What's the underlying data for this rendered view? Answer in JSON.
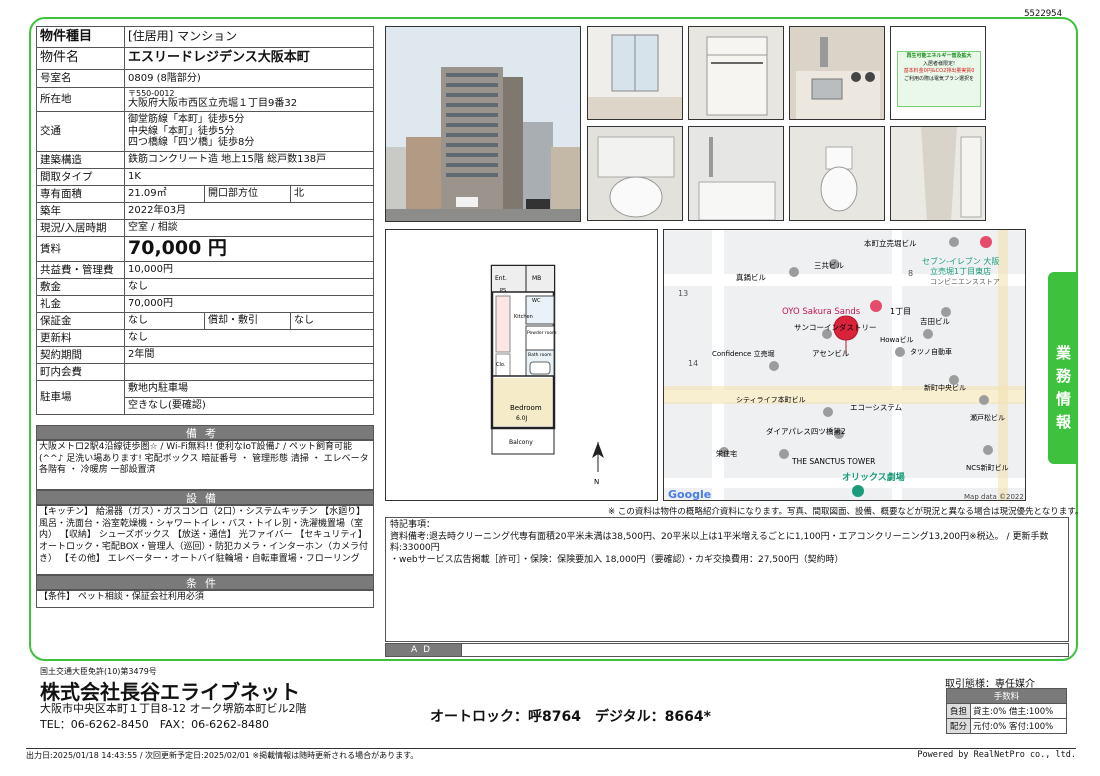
{
  "doc_id": "5522954",
  "property": {
    "type_label": "物件種目",
    "type_value": "[住居用] マンション",
    "name_label": "物件名",
    "name_value": "エスリードレジデンス大阪本町",
    "room_label": "号室名",
    "room_value": "0809 (8階部分)",
    "address_label": "所在地",
    "postal": "〒550-0012",
    "address_value": "大阪府大阪市西区立売堀１丁目9番32",
    "access_label": "交通",
    "access_lines": [
      "御堂筋線「本町」徒歩5分",
      "中央線「本町」徒歩5分",
      "四つ橋線「四ツ橋」徒歩8分"
    ],
    "structure_label": "建築構造",
    "structure_value": "鉄筋コンクリート造 地上15階 総戸数138戸",
    "layout_label": "間取タイプ",
    "layout_value": "1K",
    "area_label": "専有面積",
    "area_value": "21.09㎡",
    "direction_label": "開口部方位",
    "direction_value": "北",
    "built_label": "築年",
    "built_value": "2022年03月",
    "status_label": "現況/入居時期",
    "status_value": "空室 / 相談",
    "rent_label": "賃料",
    "rent_value": "70,000 円",
    "common_label": "共益費・管理費",
    "common_value": "10,000円",
    "deposit_label": "敷金",
    "deposit_value": "なし",
    "key_label": "礼金",
    "key_value": "70,000円",
    "guarantee_label": "保証金",
    "guarantee_value": "なし",
    "amort_label": "償却・敷引",
    "amort_value": "なし",
    "renewal_label": "更新料",
    "renewal_value": "なし",
    "contract_label": "契約期間",
    "contract_value": "2年間",
    "town_label": "町内会費",
    "town_value": "",
    "parking_label": "駐車場",
    "parking_value1": "敷地内駐車場",
    "parking_value2": "空きなし(要確認)"
  },
  "remarks": {
    "title": "備考",
    "body": "大阪メトロ2駅4沿線徒歩圏☆ / Wi-Fi無料!! 便利なIoT設備♪ / ペット飼育可能(^^♪ 足洗い場あります! 宅配ボックス 暗証番号 ・ 管理形態 清掃 ・ エレベータ 各階有 ・ 冷暖房 一部設置済"
  },
  "facilities": {
    "title": "設備",
    "body": "【キッチン】 給湯器（ガス）・ガスコンロ（2口）・システムキッチン 【水廻り】 風呂・洗面台・浴室乾燥機・シャワートイレ・バス・トイレ別・洗濯機置場（室内） 【収納】 シューズボックス 【放送・通信】 光ファイバー 【セキュリティ】 オートロック・宅配BOX・管理人（巡回）・防犯カメラ・インターホン（カメラ付き） 【その他】 エレベーター・オートバイ駐輪場・自転車置場・フローリング"
  },
  "conditions": {
    "title": "条件",
    "body": "【条件】 ペット相談・保証会社利用必須"
  },
  "poster": {
    "line1": "再生可能エネルギー普及拡大",
    "line2": "入居者様限定!",
    "line3": "基本料金0円&CO2排出量実質0",
    "line4": "ご利用の際は電気プラン選択を"
  },
  "floorplan": {
    "ent": "Ent.",
    "mb": "MB",
    "ps": "PS",
    "wc": "WC",
    "kitchen": "Kitchen",
    "powder": "Powder room",
    "bath": "Bath room",
    "clo": "Clo.",
    "bedroom": "Bedroom",
    "bedroom_size": "6.0J",
    "balcony": "Balcony",
    "north": "N"
  },
  "map": {
    "labels": [
      "本町立売堀ビル",
      "セブン-イレブン 大阪",
      "立売堀1丁目東店",
      "コンビニエンスストア",
      "真鍋ビル",
      "三共ビル",
      "13",
      "8",
      "OYO Sakura Sands",
      "1丁目",
      "吉田ビル",
      "サンコーインダストリー",
      "Confidence 立売堀",
      "アセンビル",
      "Howaビル",
      "タツノ自動車",
      "14",
      "新町中央ビル",
      "シティライフ本町ビル",
      "エコーシステム",
      "瀬戸松ビル",
      "ダイアパレス四ツ橋第2",
      "栄住宅",
      "THE SANCTUS TOWER",
      "オリックス劇場",
      "NCS新町ビル"
    ],
    "google": "Google",
    "attribution": "Map data ©2022"
  },
  "disclaimer": "※ この資料は物件の概略紹介資料になります。写真、間取図面、設備、概要などが現況と異なる場合は現況優先となります。",
  "special": {
    "title": "特記事項：",
    "line1": "資料備考:退去時クリーニング代専有面積20平米未満は38,500円、20平米以上は1平米増えるごとに1,100円・エアコンクリーニング13,200円※税込。 / 更新手数料:33000円",
    "line2": "・webサービス広告掲載［許可］・保険：保険要加入 18,000円（要確認）・カギ交換費用：27,500円（契約時）"
  },
  "ad_label": "AD",
  "side_tab": "業務情報",
  "footer": {
    "license": "国土交通大臣免許(10)第3479号",
    "company": "株式会社長谷エライブネット",
    "address": "大阪市中央区本町１丁目8-12 オーク堺筋本町ビル2階",
    "tel": "TEL：06-6262-8450　FAX：06-6262-8480",
    "autolock": "オートロック：呼8764　デジタル：8664*",
    "deal_type": "取引態様：専任媒介",
    "fee_title": "手数料",
    "burden": "負担",
    "allotment": "配分",
    "burden_values": "貸主:0% 借主:100%",
    "allot_values": "元付:0% 客付:100%",
    "timestamp": "出力日:2025/01/18 14:43:55 / 次回更新予定日:2025/02/01 ※掲載情報は随時更新される場合があります。",
    "powered": "Powered by RealNetPro co., ltd."
  }
}
